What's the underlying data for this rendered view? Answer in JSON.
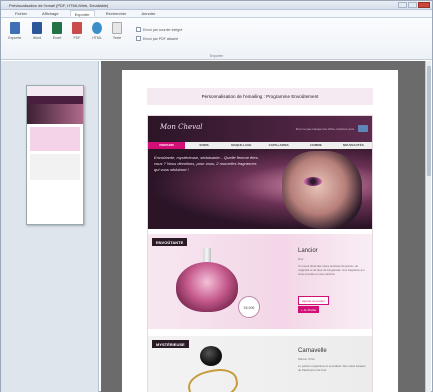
{
  "window": {
    "title": "Prévisualisation de l'email (PDF, HTML/Web, Emailable)"
  },
  "ribbon": {
    "tabs": [
      {
        "label": "Fichier",
        "active": false
      },
      {
        "label": "Affichage",
        "active": false
      },
      {
        "label": "Exporter",
        "active": true
      },
      {
        "label": "Rechercher",
        "active": false
      },
      {
        "label": "Annoter",
        "active": false
      }
    ],
    "buttons": [
      {
        "label": "Exporter",
        "icon": "export-icon",
        "color": "#3f6fb4"
      },
      {
        "label": "Word",
        "icon": "word-icon",
        "color": "#2b579a"
      },
      {
        "label": "Excel",
        "icon": "excel-icon",
        "color": "#217346"
      },
      {
        "label": "PDF",
        "icon": "pdf-icon",
        "color": "#c94b4b"
      },
      {
        "label": "HTML",
        "icon": "html-icon",
        "color": "#3a8fc9"
      },
      {
        "label": "Texte",
        "icon": "text-icon",
        "color": "#d9d9d9"
      }
    ],
    "options": [
      "Envoi par courrier intégré",
      "Envoi par PDF attaché"
    ],
    "group_label": "Exporter"
  },
  "preview": {
    "page_title": "Personnalisation de l'emailing : Programme Envoûtement",
    "email": {
      "logo": "Mon Cheval",
      "top_link": "Pour ne pas manquer les offres, inscrivez-vous",
      "nav": [
        "PARFUMS",
        "SOINS",
        "MAQUILLAGE",
        "CAPILLAIRES",
        "HOMME",
        "NOUVEAUTÉS"
      ],
      "hero_text": "Envoûtante, mystérieuse, séduisante... Quelle femme êtes-vous ? Nous dévoilons, pour vous, 2 nouvelles fragrances qui vous séduiront !",
      "products": [
        {
          "badge": "ENVOÛTANTE",
          "name": "Lancior",
          "subtitle": "Dior",
          "description": "Un coeur floral des notes ambrées de jasmin, de magnolia et de fleur de bergamote. Une fragrance qui vous envoûte et vous séduira.",
          "price": "65,90€",
          "button_outline": "Ajouter au panier",
          "button_fill": "+ Je Profite"
        },
        {
          "badge": "MYSTÉRIEUSE",
          "name": "Carnavelle",
          "subtitle": "Marcel d'Oré",
          "description": "Le parfum mystérieux et envoûtant. Des notes boisées de Patchouli et de Cuir."
        }
      ]
    }
  },
  "colors": {
    "accent": "#d10f76",
    "header_dark": "#2c1527",
    "page_bg": "#6b6b6b"
  }
}
